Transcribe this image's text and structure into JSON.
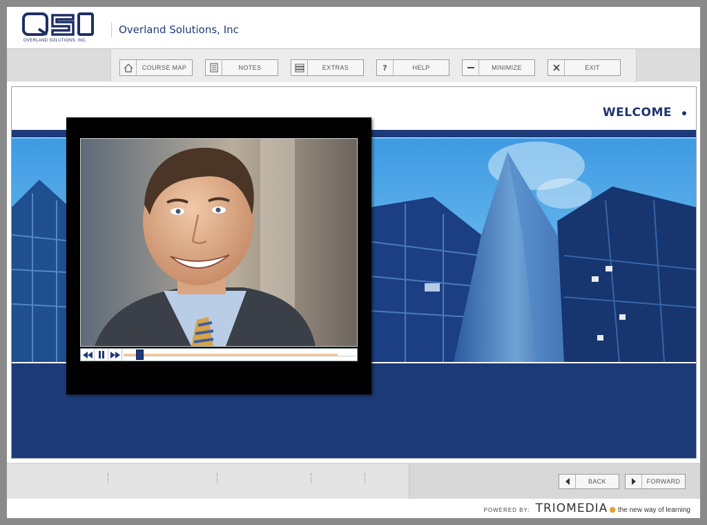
{
  "header": {
    "logo_text": "QSI",
    "logo_subtext": "OVERLAND SOLUTIONS, INC.",
    "company_name": "Overland Solutions, Inc"
  },
  "toolbar": {
    "buttons": [
      {
        "label": "COURSE MAP",
        "icon": "home-icon"
      },
      {
        "label": "NOTES",
        "icon": "notes-icon"
      },
      {
        "label": "EXTRAS",
        "icon": "archive-icon"
      },
      {
        "label": "HELP",
        "icon": "question-icon"
      },
      {
        "label": "MINIMIZE",
        "icon": "minus-icon"
      },
      {
        "label": "EXIT",
        "icon": "close-icon"
      }
    ]
  },
  "main": {
    "heading": "WELCOME"
  },
  "player": {
    "progress": 0.06,
    "controls": [
      "rewind-icon",
      "pause-icon",
      "fast-forward-icon"
    ]
  },
  "footer": {
    "back_label": "BACK",
    "forward_label": "FORWARD",
    "powered_by": "POWERED BY:",
    "brand": "TRIOMEDIA",
    "tagline": "the new way of learning"
  },
  "colors": {
    "brand_blue": "#1d3a78",
    "accent_orange": "#e3a32f"
  }
}
